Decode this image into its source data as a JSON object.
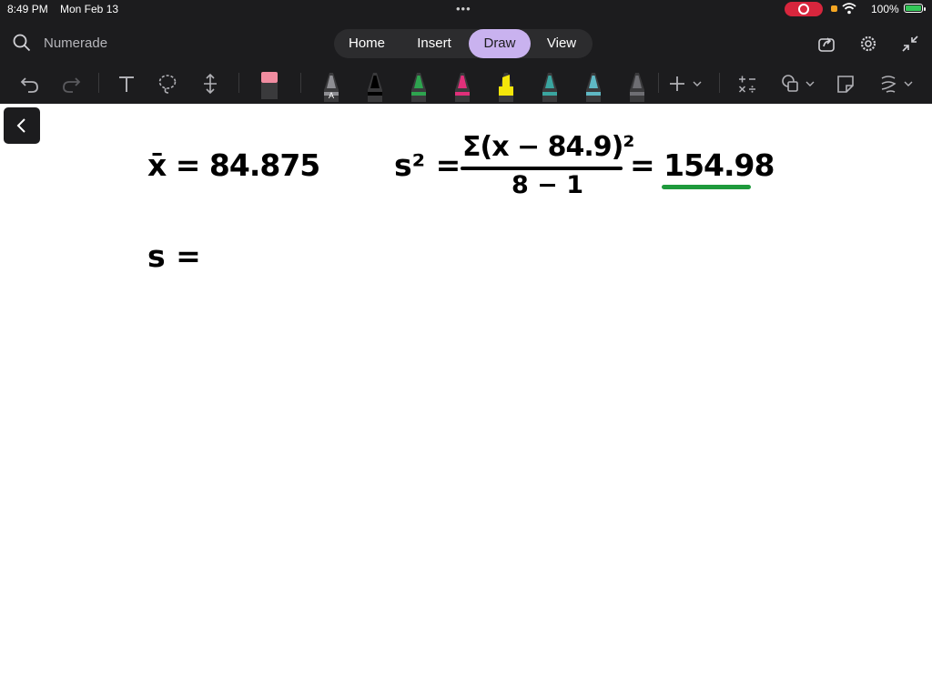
{
  "status_bar": {
    "time": "8:49 PM",
    "date": "Mon Feb 13",
    "dots": "•••",
    "battery_percent": "100%"
  },
  "header": {
    "search_label": "Numerade",
    "tabs": [
      {
        "label": "Home"
      },
      {
        "label": "Insert"
      },
      {
        "label": "Draw",
        "active": true
      },
      {
        "label": "View"
      }
    ]
  },
  "toolbar": {
    "tools": [
      "undo-icon",
      "redo-icon",
      "text-icon",
      "lasso-icon",
      "space-icon",
      "eraser-icon"
    ],
    "pens": [
      {
        "name": "pencil",
        "color": "#8e8e93",
        "label": "A"
      },
      {
        "name": "pen",
        "color": "#000000"
      },
      {
        "name": "pen",
        "color": "#2ea44f"
      },
      {
        "name": "pen",
        "color": "#e0307a"
      },
      {
        "name": "highlighter",
        "color": "#f5e60a"
      },
      {
        "name": "pen",
        "color": "#3aa5a0"
      },
      {
        "name": "pen",
        "color": "#5fb8c4"
      },
      {
        "name": "pen",
        "color": "#6e6e73"
      }
    ]
  },
  "canvas": {
    "line1_left": "x̄ = 84.875",
    "s_squared_lhs": "s² =",
    "numerator": "Σ(x − 84.9)²",
    "denominator": "8 − 1",
    "rhs": "= 154.98",
    "line2": "s ="
  },
  "colors": {
    "toolbar_bg": "#1c1c1e",
    "tab_active_bg": "#c9b2ef",
    "underline": "#1e9a3c",
    "recording": "#d7263d"
  }
}
